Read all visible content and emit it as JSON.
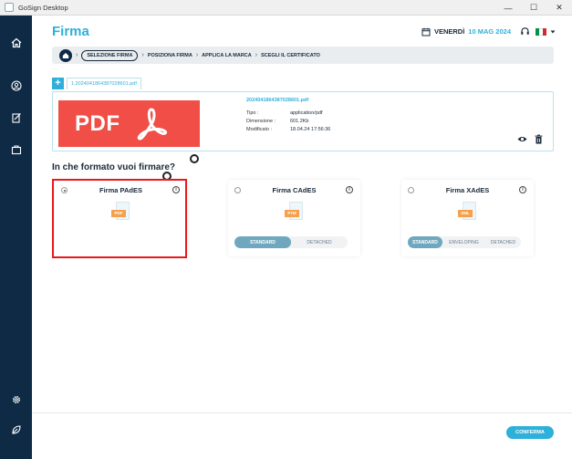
{
  "window": {
    "title": "GoSign Desktop",
    "minimize": "—",
    "maximize": "☐",
    "close": "✕"
  },
  "header": {
    "title": "Firma",
    "date_day": "VENERDÌ",
    "date_value": "10 MAG 2024"
  },
  "breadcrumb": {
    "steps": [
      "SELEZIONE FIRMA",
      "POSIZIONA FIRMA",
      "APPLICA LA MARCA",
      "SCEGLI IL CERTIFICATO"
    ],
    "separator": "›"
  },
  "file": {
    "add_label": "+",
    "tab_label": "1.20240418643870​28601.pdf",
    "name": "20240418643870​28601.pdf",
    "thumb_text": "PDF",
    "meta": [
      {
        "key": "Tipo :",
        "value": "application/pdf"
      },
      {
        "key": "Dimensione :",
        "value": "601.2Kb"
      },
      {
        "key": "Modificato :",
        "value": "18.04.24 17:56:36"
      }
    ]
  },
  "formats": {
    "question": "In che formato vuoi firmare?",
    "info_glyph": "i",
    "cards": [
      {
        "title": "Firma PAdES",
        "badge": "PDF",
        "selected": true
      },
      {
        "title": "Firma CAdES",
        "badge": "P7M",
        "selected": false,
        "options": [
          "STANDARD",
          "DETACHED"
        ],
        "active_option": "STANDARD"
      },
      {
        "title": "Firma XAdES",
        "badge": "XML",
        "selected": false,
        "options": [
          "STANDARD",
          "ENVELOPING",
          "DETACHED"
        ],
        "active_option": "STANDARD"
      }
    ]
  },
  "footer": {
    "confirm_label": "CONFERMA"
  },
  "colors": {
    "accent": "#2fb0da",
    "sidebar": "#0f2a44",
    "pdf_red": "#f04e46",
    "badge_orange": "#f6a04d",
    "highlight": "#e8191e"
  }
}
